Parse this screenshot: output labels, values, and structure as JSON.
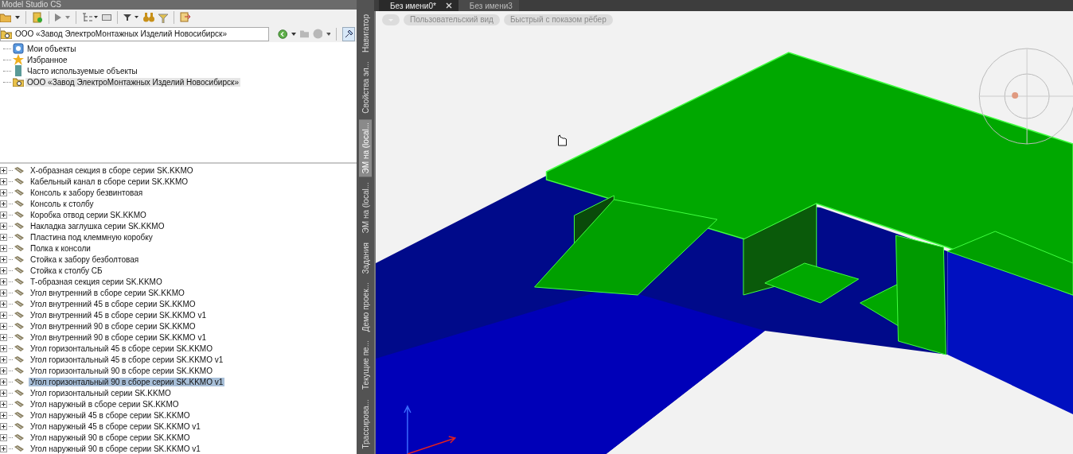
{
  "window": {
    "title": "Model Studio CS"
  },
  "address_field": {
    "value": "ООО «Завод ЭлектроМонтажных Изделий Новосибирск»"
  },
  "object_tree": [
    {
      "label": "Мои объекты",
      "kind": "my",
      "selected": false
    },
    {
      "label": "Избранное",
      "kind": "favorites",
      "selected": false
    },
    {
      "label": "Часто используемые объекты",
      "kind": "frequent",
      "selected": false
    },
    {
      "label": "ООО «Завод ЭлектроМонтажных Изделий Новосибирск»",
      "kind": "org",
      "selected": true
    }
  ],
  "elements_list": [
    {
      "label": "Х-образная секция в сборе серии SK.KKMO",
      "selected": false
    },
    {
      "label": "Кабельный канал в сборе серии SK.KKMO",
      "selected": false
    },
    {
      "label": "Консоль к забору безвинтовая",
      "selected": false
    },
    {
      "label": "Консоль к столбу",
      "selected": false
    },
    {
      "label": "Коробка отвод серии SK.KKMO",
      "selected": false
    },
    {
      "label": "Накладка заглушка серии SK.KKMO",
      "selected": false
    },
    {
      "label": "Пластина под клеммную коробку",
      "selected": false
    },
    {
      "label": "Полка к консоли",
      "selected": false
    },
    {
      "label": "Стойка к забору безболтовая",
      "selected": false
    },
    {
      "label": "Стойка к столбу СБ",
      "selected": false
    },
    {
      "label": "Т-образная секция серии SK.KKMO",
      "selected": false
    },
    {
      "label": "Угол внутренний в сборе серии SK.KKMO",
      "selected": false
    },
    {
      "label": "Угол внутренний 45 в сборе серии SK.KKMO",
      "selected": false
    },
    {
      "label": "Угол внутренний 45 в сборе серии SK.KKMO v1",
      "selected": false
    },
    {
      "label": "Угол внутренний 90 в сборе серии SK.KKMO",
      "selected": false
    },
    {
      "label": "Угол внутренний 90 в сборе серии SK.KKMO v1",
      "selected": false
    },
    {
      "label": "Угол горизонтальный 45 в сборе серии SK.KKMO",
      "selected": false
    },
    {
      "label": "Угол горизонтальный 45 в сборе серии SK.KKMO v1",
      "selected": false
    },
    {
      "label": "Угол горизонтальный 90 в сборе серии SK.KKMO",
      "selected": false
    },
    {
      "label": "Угол горизонтальный 90 в сборе серии SK.KKMO v1",
      "selected": true
    },
    {
      "label": "Угол горизонтальный серии SK.KKMO",
      "selected": false
    },
    {
      "label": "Угол наружный в сборе серии SK.KKMO",
      "selected": false
    },
    {
      "label": "Угол наружный 45 в сборе серии SK.KKMO",
      "selected": false
    },
    {
      "label": "Угол наружный 45 в сборе серии SK.KKMO v1",
      "selected": false
    },
    {
      "label": "Угол наружный 90 в сборе серии SK.KKMO",
      "selected": false
    },
    {
      "label": "Угол наружный 90 в сборе серии SK.KKMO v1",
      "selected": false
    }
  ],
  "side_tabs": [
    {
      "label": "Навигатор",
      "selected": false
    },
    {
      "label": "Свойства эл...",
      "selected": false
    },
    {
      "label": "ЭМ на (local...",
      "selected": true
    },
    {
      "label": "ЭМ на (local...",
      "selected": false
    },
    {
      "label": "Задания",
      "selected": false
    },
    {
      "label": "Демо проек...",
      "selected": false
    },
    {
      "label": "Текущие пе...",
      "selected": false
    },
    {
      "label": "Трассирова...",
      "selected": false
    }
  ],
  "document_tabs": [
    {
      "label": "Без имени0*",
      "selected": true,
      "closable": true
    },
    {
      "label": "Без имени3",
      "selected": false,
      "closable": false
    }
  ],
  "view_chips": [
    "Пользовательский вид",
    "Быстрый с показом рёбер"
  ]
}
